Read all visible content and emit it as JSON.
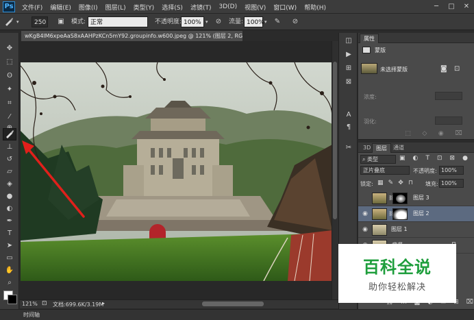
{
  "app": {
    "logo": "Ps"
  },
  "menu": [
    "文件(F)",
    "编辑(E)",
    "图像(I)",
    "图层(L)",
    "类型(Y)",
    "选择(S)",
    "滤镜(T)",
    "3D(D)",
    "视图(V)",
    "窗口(W)",
    "帮助(H)"
  ],
  "options": {
    "brush_size": "250",
    "mode_label": "模式:",
    "mode_value": "正常",
    "opacity_label": "不透明度:",
    "opacity_value": "100%",
    "flow_label": "流量:",
    "flow_value": "100%"
  },
  "document": {
    "tab_title": "wKgB4lM6xpeAaS8xAAHPzKCn5mY92.groupinfo.w600.jpeg @ 121% (图层 2, RGB/8#) *",
    "zoom": "121%",
    "doc_info": "文档:699.6K/3.19M",
    "timeline": "时间轴"
  },
  "properties": {
    "tab": "属性",
    "kind": "蒙版",
    "layer_mask": "未选择蒙版",
    "density_label": "浓度:",
    "feather_label": "羽化:"
  },
  "layers": {
    "tabs": [
      "3D",
      "图层",
      "通道"
    ],
    "filter_type": "类型",
    "blend_mode": "正片叠底",
    "opacity_label": "不透明度:",
    "opacity_value": "100%",
    "lock_label": "锁定:",
    "fill_label": "填充:",
    "fill_value": "100%",
    "items": [
      {
        "name": "图层 3"
      },
      {
        "name": "图层 2"
      },
      {
        "name": "图层 1"
      },
      {
        "name": "背景"
      }
    ]
  },
  "watermark": {
    "title": "百科全说",
    "subtitle": "助你轻松解决"
  },
  "colors": {
    "accent": "#2f8fd8",
    "selected_layer": "#5c6a80",
    "arrow": "#e0201b",
    "watermark_green": "#1e9e3c"
  }
}
